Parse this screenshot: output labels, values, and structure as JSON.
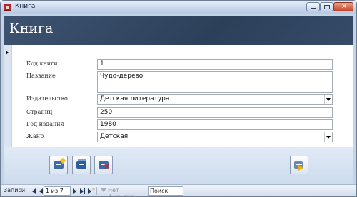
{
  "window": {
    "title": "Книга"
  },
  "form": {
    "header_title": "Книга",
    "fields": [
      {
        "label": "Код книги",
        "value": "1"
      },
      {
        "label": "Название",
        "value": "Чудо-дерево"
      },
      {
        "label": "Издательство",
        "value": "Детская литература"
      },
      {
        "label": "Страниц",
        "value": "250"
      },
      {
        "label": "Год издания",
        "value": "1980"
      },
      {
        "label": "Жанр",
        "value": "Детская"
      }
    ]
  },
  "statusbar": {
    "records_label": "Записи:",
    "position": "1 из 7",
    "filter_label": "Нет фильтра",
    "search_placeholder": "Поиск"
  }
}
